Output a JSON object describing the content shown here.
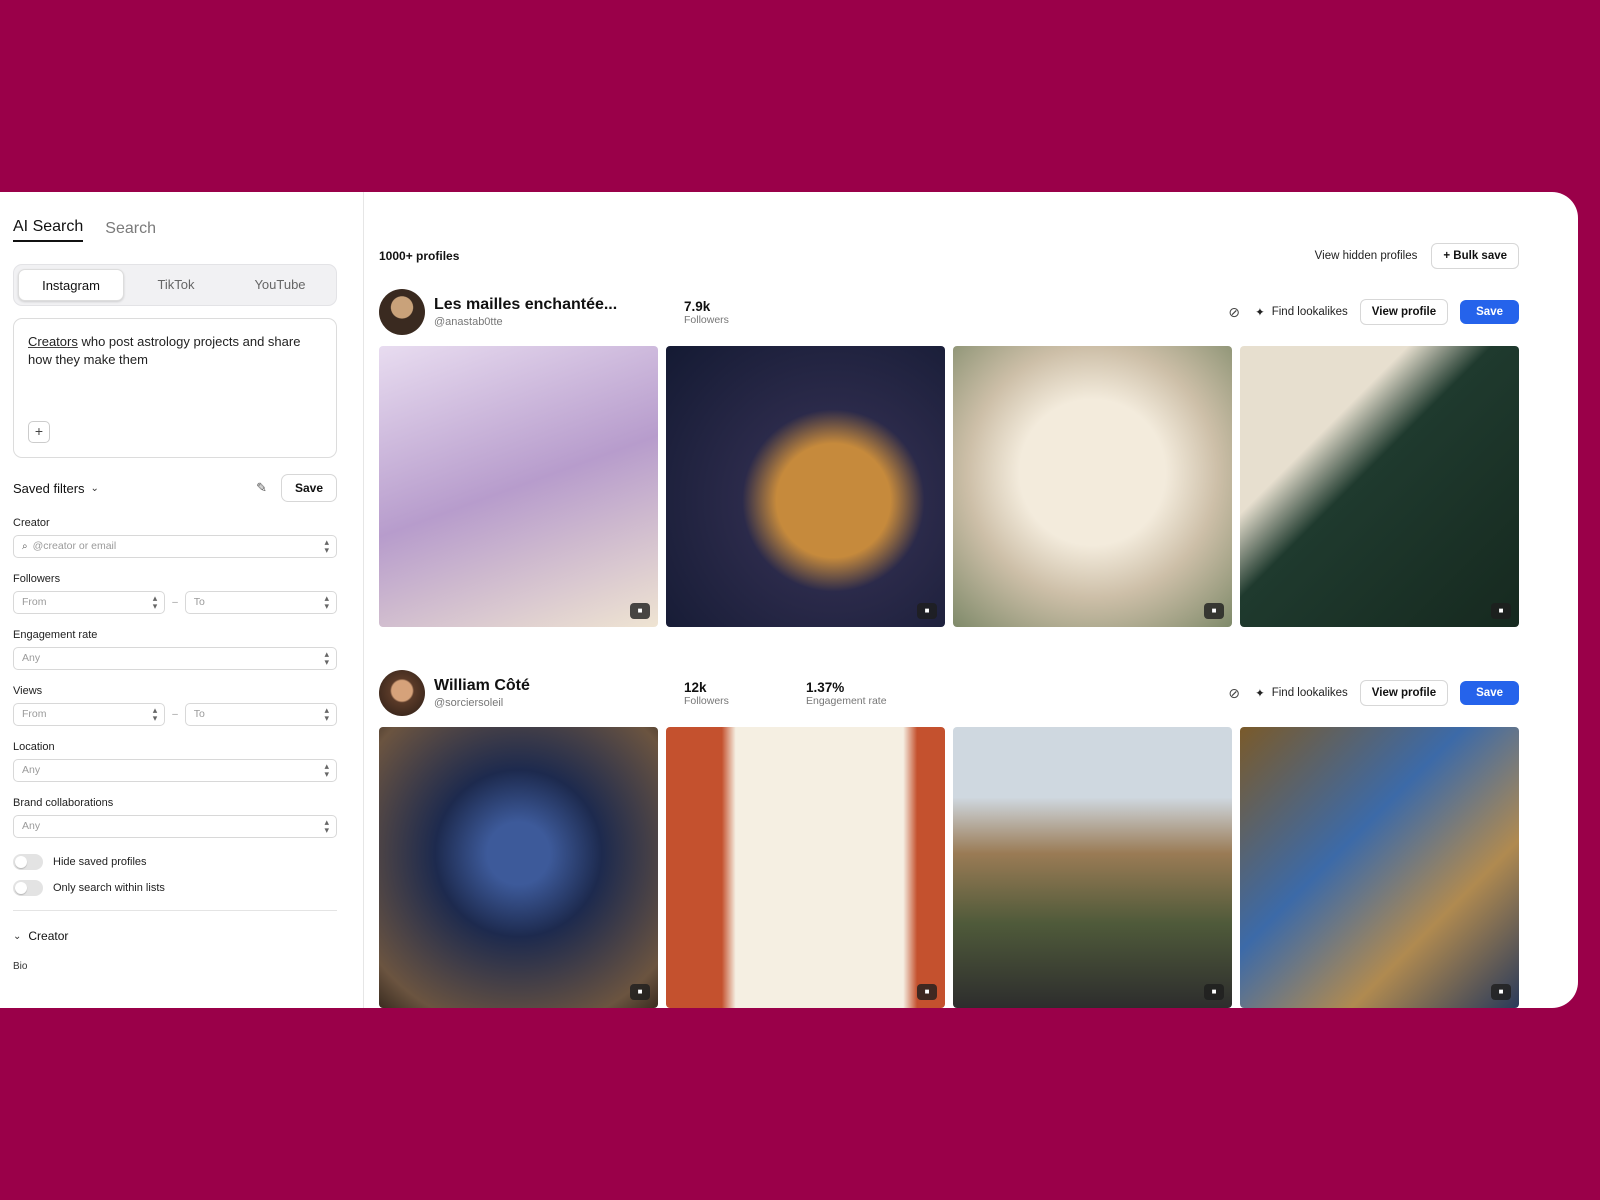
{
  "sidebar": {
    "tabs": [
      "AI Search",
      "Search"
    ],
    "platforms": [
      "Instagram",
      "TikTok",
      "YouTube"
    ],
    "prompt_underlined": "Creators",
    "prompt_rest": " who post astrology projects and share how they make them",
    "plus": "+",
    "saved_filters": "Saved filters",
    "save": "Save",
    "filters": {
      "creator_label": "Creator",
      "creator_placeholder": "@creator or email",
      "followers_label": "Followers",
      "from": "From",
      "to": "To",
      "engagement_label": "Engagement rate",
      "any": "Any",
      "views_label": "Views",
      "location_label": "Location",
      "brand_label": "Brand collaborations"
    },
    "toggles": [
      "Hide saved profiles",
      "Only search within lists"
    ],
    "section_creator": "Creator",
    "bio": "Bio"
  },
  "main": {
    "count": "1000+ profiles",
    "view_hidden": "View hidden profiles",
    "bulk_save": "+ Bulk save",
    "find_lookalikes": "Find lookalikes",
    "view_profile": "View profile",
    "save": "Save",
    "profiles": [
      {
        "name": "Les mailles enchantée...",
        "handle": "@anastab0tte",
        "followers": "7.9k",
        "followers_label": "Followers"
      },
      {
        "name": "William Côté",
        "handle": "@sorciersoleil",
        "followers": "12k",
        "followers_label": "Followers",
        "engagement": "1.37%",
        "engagement_label": "Engagement rate"
      }
    ]
  },
  "colors": {
    "background": "#9a0049",
    "accent": "#2563eb"
  }
}
